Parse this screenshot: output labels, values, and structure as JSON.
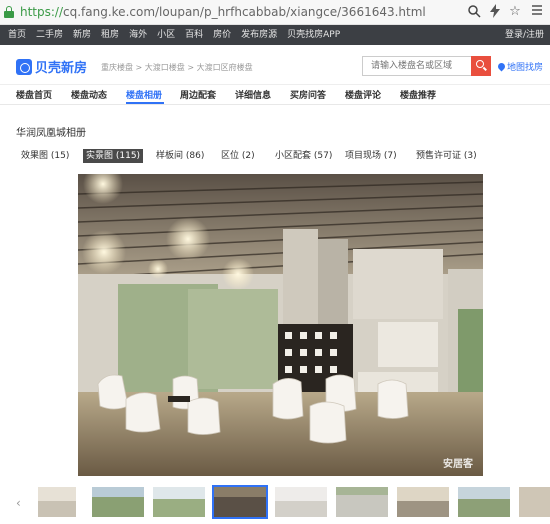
{
  "browser": {
    "url_scheme": "https://",
    "url_rest": "cq.fang.ke.com/loupan/p_hrfhcabbab/xiangce/3661643.html",
    "icons": [
      "lock-icon",
      "search-icon",
      "lightning-icon",
      "star-icon",
      "menu-icon"
    ]
  },
  "top_nav": {
    "items": [
      "首页",
      "二手房",
      "新房",
      "租房",
      "海外",
      "小区",
      "百科",
      "房价",
      "发布房源",
      "贝壳找房APP"
    ],
    "login": "登录/注册"
  },
  "header": {
    "logo_text": "贝壳新房",
    "breadcrumb": "重庆楼盘 > 大渡口楼盘 > 大渡口区府楼盘",
    "search_placeholder": "请输入楼盘名或区域",
    "map_link": "地图找房"
  },
  "tabs": [
    {
      "label": "楼盘首页",
      "active": false
    },
    {
      "label": "楼盘动态",
      "active": false
    },
    {
      "label": "楼盘相册",
      "active": true
    },
    {
      "label": "周边配套",
      "active": false
    },
    {
      "label": "详细信息",
      "active": false
    },
    {
      "label": "买房问答",
      "active": false
    },
    {
      "label": "楼盘评论",
      "active": false
    },
    {
      "label": "楼盘推荐",
      "active": false
    }
  ],
  "album": {
    "title": "华润凤凰城相册",
    "filters": [
      {
        "label": "效果图 (15)",
        "active": false
      },
      {
        "label": "实景图 (115)",
        "active": true
      },
      {
        "label": "样板间 (86)",
        "active": false
      },
      {
        "label": "区位 (2)",
        "active": false
      },
      {
        "label": "小区配套 (57)",
        "active": false
      },
      {
        "label": "项目现场 (7)",
        "active": false
      },
      {
        "label": "预售许可证 (3)",
        "active": false
      }
    ],
    "watermark": "安居客"
  },
  "colors": {
    "accent": "#3072f6",
    "top_nav_bg": "#3c3f44",
    "search_button": "#e94f3e",
    "secure_green": "#3a9a46"
  }
}
